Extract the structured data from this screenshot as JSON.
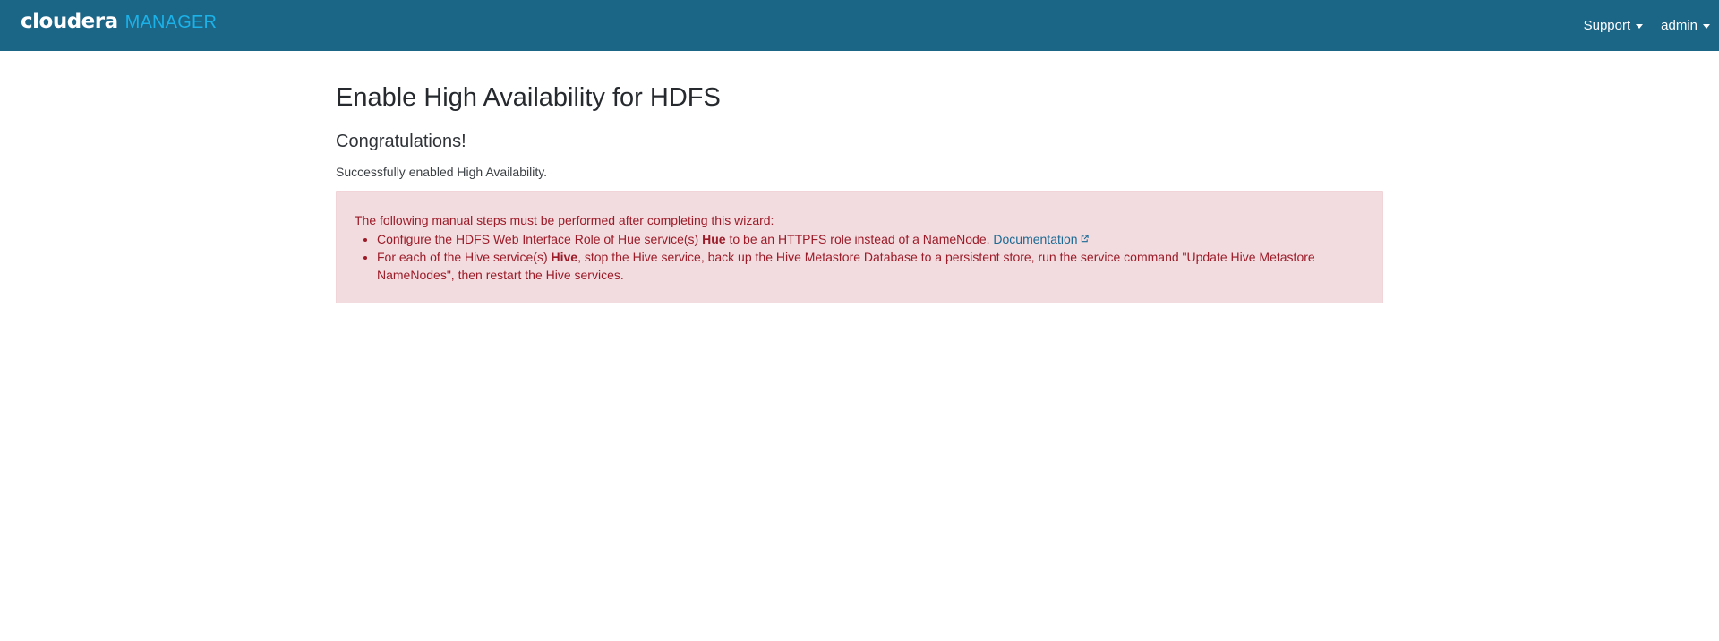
{
  "header": {
    "logo_primary": "cloudera",
    "logo_secondary": "MANAGER",
    "support_label": "Support",
    "user_label": "admin"
  },
  "page": {
    "title": "Enable High Availability for HDFS",
    "subtitle": "Congratulations!",
    "success_message": "Successfully enabled High Availability."
  },
  "alert": {
    "intro": "The following manual steps must be performed after completing this wizard:",
    "step1": {
      "before": "Configure the HDFS Web Interface Role of Hue service(s) ",
      "bold": "Hue",
      "after": " to be an HTTPFS role instead of a NameNode. ",
      "link": "Documentation"
    },
    "step2": {
      "before": "For each of the Hive service(s) ",
      "bold": "Hive",
      "after": ", stop the Hive service, back up the Hive Metastore Database to a persistent store, run the service command \"Update Hive Metastore NameNodes\", then restart the Hive services."
    }
  },
  "colors": {
    "header_bg": "#1b6587",
    "logo_accent": "#1ab2e8",
    "alert_bg": "#f2dcdf",
    "alert_text": "#9c1b28",
    "link": "#1c6a94"
  },
  "icons": {
    "dropdown": "caret-down-icon",
    "external": "external-link-icon"
  }
}
